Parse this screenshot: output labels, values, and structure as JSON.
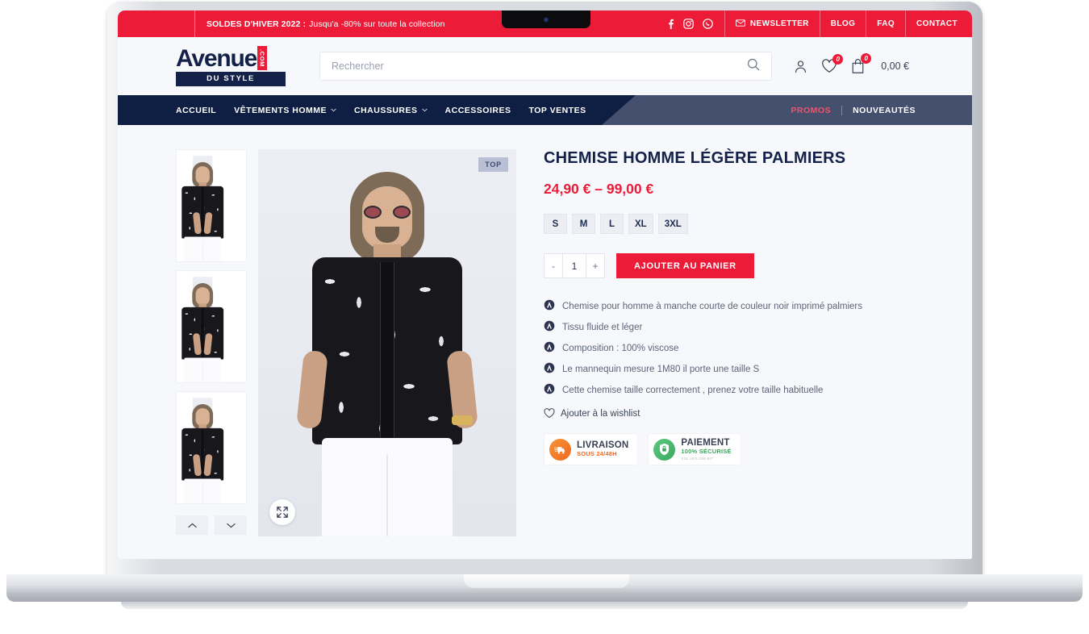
{
  "topbar": {
    "promo_label": "SOLDES D'HIVER 2022 :",
    "promo_text": "Jusqu'a -80% sur toute la collection",
    "social": [
      {
        "name": "facebook-icon"
      },
      {
        "name": "instagram-icon"
      },
      {
        "name": "whatsapp-icon"
      }
    ],
    "links": [
      {
        "label": "NEWSLETTER",
        "icon": "mail-icon"
      },
      {
        "label": "BLOG",
        "icon": ""
      },
      {
        "label": "FAQ",
        "icon": ""
      },
      {
        "label": "CONTACT",
        "icon": ""
      }
    ]
  },
  "header": {
    "logo_word": "Avenue",
    "logo_dotcom": ".COM",
    "logo_sub": "DU STYLE",
    "search_placeholder": "Rechercher",
    "search_value": "",
    "wishlist_count": "0",
    "cart_count": "0",
    "cart_total": "0,00 €"
  },
  "nav": {
    "items": [
      {
        "label": "ACCUEIL",
        "has_chevron": false
      },
      {
        "label": "VÊTEMENTS HOMME",
        "has_chevron": true
      },
      {
        "label": "CHAUSSURES",
        "has_chevron": true
      },
      {
        "label": "ACCESSOIRES",
        "has_chevron": false
      },
      {
        "label": "TOP VENTES",
        "has_chevron": false
      }
    ],
    "promos_label": "PROMOS",
    "nouveautes_label": "NOUVEAUTÉS"
  },
  "product": {
    "badge": "TOP",
    "title": "CHEMISE HOMME LÉGÈRE PALMIERS",
    "price": "24,90 € – 99,00 €",
    "sizes": [
      "S",
      "M",
      "L",
      "XL",
      "3XL"
    ],
    "qty_minus": "-",
    "qty_value": "1",
    "qty_plus": "+",
    "add_to_cart": "AJOUTER AU PANIER",
    "features": [
      "Chemise pour homme  à manche courte de couleur noir imprimé palmiers",
      "Tissu fluide et léger",
      "Composition : 100% viscose",
      "Le mannequin mesure 1M80 il porte une taille S",
      "Cette chemise taille correctement , prenez votre taille habituelle"
    ],
    "wishlist_label": "Ajouter à la wishlist",
    "trust_badges": [
      {
        "title": "LIVRAISON",
        "subtitle": "SOUS 24/48H",
        "fine": "",
        "icon": "delivery-truck-icon"
      },
      {
        "title": "PAIEMENT",
        "subtitle": "100% SÉCURISÉ",
        "fine": "SSL AES 256-BIT",
        "icon": "shield-lock-icon"
      }
    ]
  },
  "colors": {
    "red": "#ec1c39",
    "navy": "#0f1f43",
    "slate": "#45506e",
    "page_bg": "#f7f8fc",
    "orange": "#ef6a23",
    "green": "#3aa85e"
  }
}
